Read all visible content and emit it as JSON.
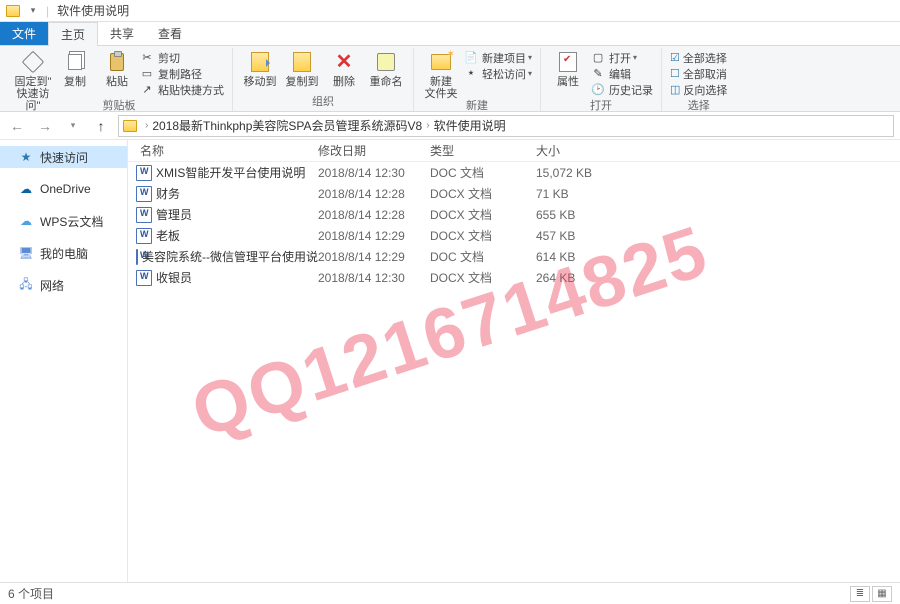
{
  "window": {
    "title": "软件使用说明"
  },
  "tabs": {
    "file": "文件",
    "home": "主页",
    "share": "共享",
    "view": "查看"
  },
  "ribbon": {
    "clipboard": {
      "label": "剪贴板",
      "pin": "固定到\"\n快速访问\"",
      "copy": "复制",
      "paste": "粘贴",
      "cut": "剪切",
      "copypath": "复制路径",
      "pasteshortcut": "粘贴快捷方式"
    },
    "organize": {
      "label": "组织",
      "moveto": "移动到",
      "copyto": "复制到",
      "delete": "删除",
      "rename": "重命名"
    },
    "new": {
      "label": "新建",
      "newfolder": "新建\n文件夹",
      "newitem": "新建项目",
      "easyaccess": "轻松访问"
    },
    "open": {
      "label": "打开",
      "properties": "属性",
      "open": "打开",
      "edit": "编辑",
      "history": "历史记录"
    },
    "select": {
      "label": "选择",
      "selectall": "全部选择",
      "selectnone": "全部取消",
      "invert": "反向选择"
    }
  },
  "breadcrumb": {
    "seg1": "2018最新Thinkphp美容院SPA会员管理系统源码V8",
    "seg2": "软件使用说明"
  },
  "sidebar": {
    "quick": "快速访问",
    "onedrive": "OneDrive",
    "wps": "WPS云文档",
    "thispc": "我的电脑",
    "network": "网络"
  },
  "columns": {
    "name": "名称",
    "date": "修改日期",
    "type": "类型",
    "size": "大小"
  },
  "files": [
    {
      "name": "XMIS智能开发平台使用说明",
      "date": "2018/8/14 12:30",
      "type": "DOC 文档",
      "size": "15,072 KB"
    },
    {
      "name": "财务",
      "date": "2018/8/14 12:28",
      "type": "DOCX 文档",
      "size": "71 KB"
    },
    {
      "name": "管理员",
      "date": "2018/8/14 12:28",
      "type": "DOCX 文档",
      "size": "655 KB"
    },
    {
      "name": "老板",
      "date": "2018/8/14 12:29",
      "type": "DOCX 文档",
      "size": "457 KB"
    },
    {
      "name": "美容院系统--微信管理平台使用说明",
      "date": "2018/8/14 12:29",
      "type": "DOC 文档",
      "size": "614 KB"
    },
    {
      "name": "收银员",
      "date": "2018/8/14 12:30",
      "type": "DOCX 文档",
      "size": "264 KB"
    }
  ],
  "status": {
    "count": "6 个项目"
  },
  "watermark": "QQ1216714825"
}
